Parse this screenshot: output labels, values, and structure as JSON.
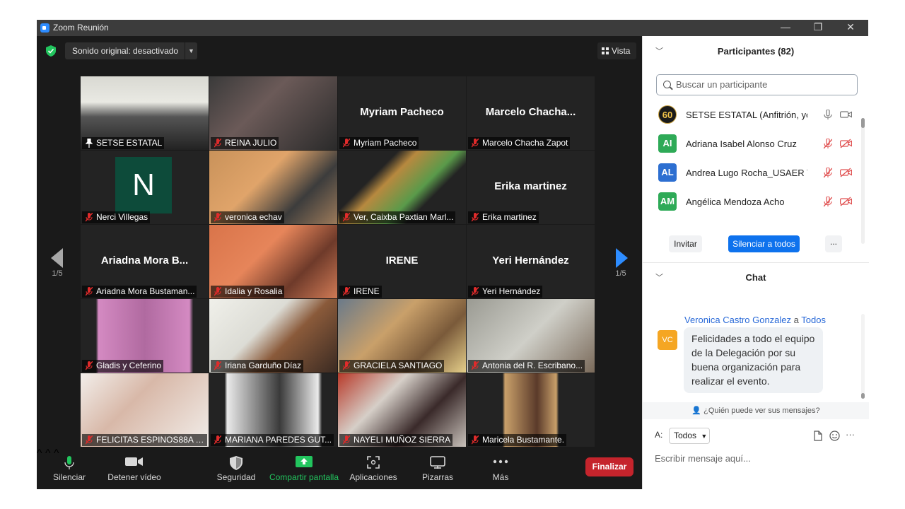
{
  "window": {
    "title": "Zoom Reunión"
  },
  "video_top": {
    "sound_label": "Sonido original: desactivado",
    "view_label": "Vista"
  },
  "pager": {
    "left": "1/5",
    "right": "1/5"
  },
  "tiles": [
    {
      "name": "SETSE ESTATAL",
      "big": "",
      "kind": "photo",
      "active": true
    },
    {
      "name": "REINA JULIO",
      "big": "",
      "kind": "photo"
    },
    {
      "name": "Myriam Pacheco",
      "big": "Myriam Pacheco",
      "kind": "name"
    },
    {
      "name": "Marcelo Chacha Zapot",
      "big": "Marcelo  Chacha...",
      "kind": "name"
    },
    {
      "name": "Nerci Villegas",
      "big": "N",
      "kind": "initial"
    },
    {
      "name": "veronica echav",
      "big": "",
      "kind": "photo"
    },
    {
      "name": "Ver, Caixba Paxtian Marl...",
      "big": "",
      "kind": "photo"
    },
    {
      "name": "Erika martinez",
      "big": "Erika martinez",
      "kind": "name"
    },
    {
      "name": "Ariadna Mora Bustaman...",
      "big": "Ariadna  Mora  B...",
      "kind": "name"
    },
    {
      "name": "Idalia y Rosalia",
      "big": "",
      "kind": "photo"
    },
    {
      "name": "IRENE",
      "big": "IRENE",
      "kind": "name"
    },
    {
      "name": "Yeri Hernández",
      "big": "Yeri Hernández",
      "kind": "name"
    },
    {
      "name": "Gladis y Ceferino",
      "big": "",
      "kind": "photo"
    },
    {
      "name": "Iriana Garduño Díaz",
      "big": "",
      "kind": "photo"
    },
    {
      "name": "GRACIELA SANTIAGO",
      "big": "",
      "kind": "photo"
    },
    {
      "name": "Antonia del R. Escribano...",
      "big": "",
      "kind": "photo"
    },
    {
      "name": "FELICITAS ESPINOS88A P...",
      "big": "",
      "kind": "photo"
    },
    {
      "name": "MARIANA PAREDES GUT...",
      "big": "",
      "kind": "photo"
    },
    {
      "name": "NAYELI MUÑOZ SIERRA",
      "big": "",
      "kind": "photo"
    },
    {
      "name": "Maricela Bustamante.",
      "big": "",
      "kind": "photo"
    }
  ],
  "toolbar": {
    "mute": "Silenciar",
    "video": "Detener vídeo",
    "security": "Seguridad",
    "share": "Compartir pantalla",
    "apps": "Aplicaciones",
    "whiteboard": "Pizarras",
    "more": "Más",
    "end": "Finalizar"
  },
  "participants": {
    "header": "Participantes (82)",
    "search_placeholder": "Buscar un participante",
    "list": [
      {
        "initials": "60",
        "name": "SETSE ESTATAL (Anfitrión, yo)",
        "color": "#1a1a1a",
        "muted": false
      },
      {
        "initials": "AI",
        "name": "Adriana Isabel Alonso Cruz",
        "color": "#2eaa57",
        "muted": true
      },
      {
        "initials": "AL",
        "name": "Andrea Lugo Rocha_USAER T",
        "color": "#2d6fd1",
        "muted": true
      },
      {
        "initials": "AM",
        "name": "Angélica Mendoza Acho",
        "color": "#2eaa57",
        "muted": true
      }
    ],
    "invite": "Invitar",
    "mute_all": "Silenciar a todos",
    "more": "..."
  },
  "chat": {
    "header": "Chat",
    "sender": "Veronica Castro Gonzalez",
    "to_word": "a",
    "recipient": "Todos",
    "avatar": "VC",
    "message": "Felicidades a todo el equipo de la Delegación por su buena organización para realizar el evento.",
    "who_can_see": "¿Quién puede ver sus mensajes?",
    "to_label": "A:",
    "to_value": "Todos",
    "input_placeholder": "Escribir mensaje aquí..."
  },
  "colors": {
    "accent_green": "#22c55e",
    "end_red": "#c5242c",
    "mute_all_blue": "#0e72ed",
    "active_border": "#e6e85a"
  }
}
